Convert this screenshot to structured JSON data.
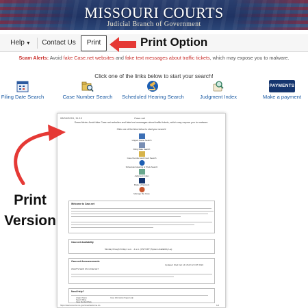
{
  "header": {
    "title": "MISSOURI COURTS",
    "subtitle": "Judicial Branch of Government"
  },
  "nav": {
    "help": "Help",
    "contact": "Contact Us",
    "print": "Print"
  },
  "annotations": {
    "print_option": "Print Option",
    "print_version_line1": "Print",
    "print_version_line2": "Version",
    "arrow_color": "#e53935"
  },
  "scam_alert": {
    "label": "Scam Alerts:",
    "text1": "Avoid",
    "link1": "fake Case.net websites",
    "text2": "and",
    "link2": "fake text messages about traffic tickets",
    "text3": ", which may expose you to malware."
  },
  "prompt": "Click one of the links below to start your search!",
  "quick_links": [
    {
      "label": "Filing Date Search",
      "icon": "calendar-icon"
    },
    {
      "label": "Case Number Search",
      "icon": "folder-search-icon"
    },
    {
      "label": "Scheduled Hearing Search",
      "icon": "gavel-icon"
    },
    {
      "label": "Judgment Index",
      "icon": "magnifier-scroll-icon"
    },
    {
      "label": "Make a payment",
      "icon": "payments-icon"
    }
  ],
  "payments_badge": "PAYMENTS",
  "preview": {
    "date": "08/04/2024, 11:10",
    "page_title": "Case.net",
    "scam": "Scam Alerts: Avoid fake Case.net websites and fake text messages about traffic tickets, which may expose you to malware.",
    "prompt": "Click one of the links below to start your search!",
    "links": [
      "Litigant Name Search",
      "Filing Date Search",
      "Case Number and Court Search",
      "Scheduled Hearing & Trials Search",
      "Judgment Index",
      "Make a Payment",
      "Manage My Case"
    ],
    "sections": {
      "welcome": "Welcome to Case.net",
      "availability": "Case.net Availability",
      "availability_text": "Monday through Friday 4 a.m. - 1 a.m. (CST/CDT) System Availability Log",
      "announcements": "Case.net Announcements",
      "updated": "Updated: Wed Feb 14 15:22:12 CST 2024",
      "whats_new": "WHAT'S NEW ON CASE.NET",
      "help": "Need Help?"
    },
    "help_items": [
      "Litigant Name",
      "Search Filing",
      "Case Number/Party",
      "Case Information Pages Help"
    ],
    "url": "https://www.courts.mo.gov/cnet/welcome.do",
    "page_num": "1/2"
  }
}
